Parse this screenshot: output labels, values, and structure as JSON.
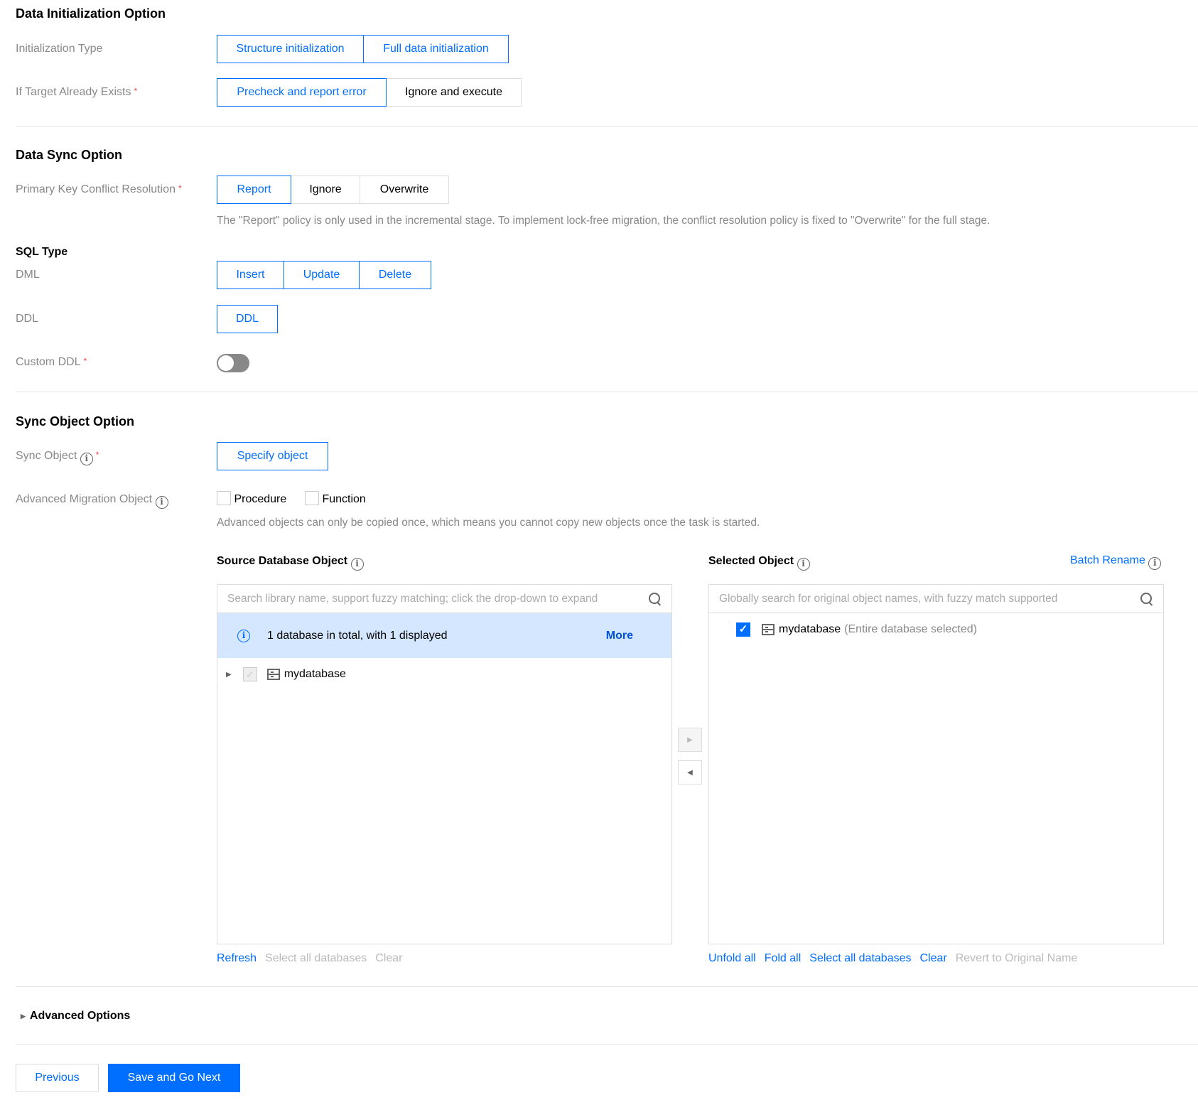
{
  "data_init": {
    "title": "Data Initialization Option",
    "init_type_label": "Initialization Type",
    "init_options": [
      "Structure initialization",
      "Full data initialization"
    ],
    "target_exists_label": "If Target Already Exists",
    "target_options": [
      "Precheck and report error",
      "Ignore and execute"
    ],
    "required_mark": "*"
  },
  "data_sync": {
    "title": "Data Sync Option",
    "pk_label": "Primary Key Conflict Resolution",
    "pk_options": [
      "Report",
      "Ignore",
      "Overwrite"
    ],
    "pk_hint": "The \"Report\" policy is only used in the incremental stage. To implement lock-free migration, the conflict resolution policy is fixed to \"Overwrite\" for the full stage.",
    "sql_type_title": "SQL Type",
    "dml_label": "DML",
    "dml_options": [
      "Insert",
      "Update",
      "Delete"
    ],
    "ddl_label": "DDL",
    "ddl_option": "DDL",
    "custom_ddl_label": "Custom DDL"
  },
  "sync_object": {
    "title": "Sync Object Option",
    "sync_object_label": "Sync Object",
    "specify_button": "Specify object",
    "advanced_label": "Advanced Migration Object",
    "procedure": "Procedure",
    "function": "Function",
    "advanced_hint": "Advanced objects can only be copied once, which means you cannot copy new objects once the task is started.",
    "source": {
      "title": "Source Database Object",
      "placeholder": "Search library name, support fuzzy matching; click the drop-down to expand",
      "banner": "1 database in total, with 1 displayed",
      "more": "More",
      "item": "mydatabase",
      "refresh": "Refresh",
      "select_all": "Select all databases",
      "clear": "Clear"
    },
    "selected": {
      "title": "Selected Object",
      "batch_rename": "Batch Rename",
      "placeholder": "Globally search for original object names, with fuzzy match supported",
      "item": "mydatabase",
      "item_note": "(Entire database selected)",
      "unfold_all": "Unfold all",
      "fold_all": "Fold all",
      "select_all": "Select all databases",
      "clear": "Clear",
      "revert": "Revert to Original Name"
    }
  },
  "advanced_options": "Advanced Options",
  "footer": {
    "previous": "Previous",
    "next": "Save and Go Next"
  },
  "colors": {
    "accent": "#006eff",
    "required": "#e54545",
    "banner_bg": "#d5e7ff"
  }
}
